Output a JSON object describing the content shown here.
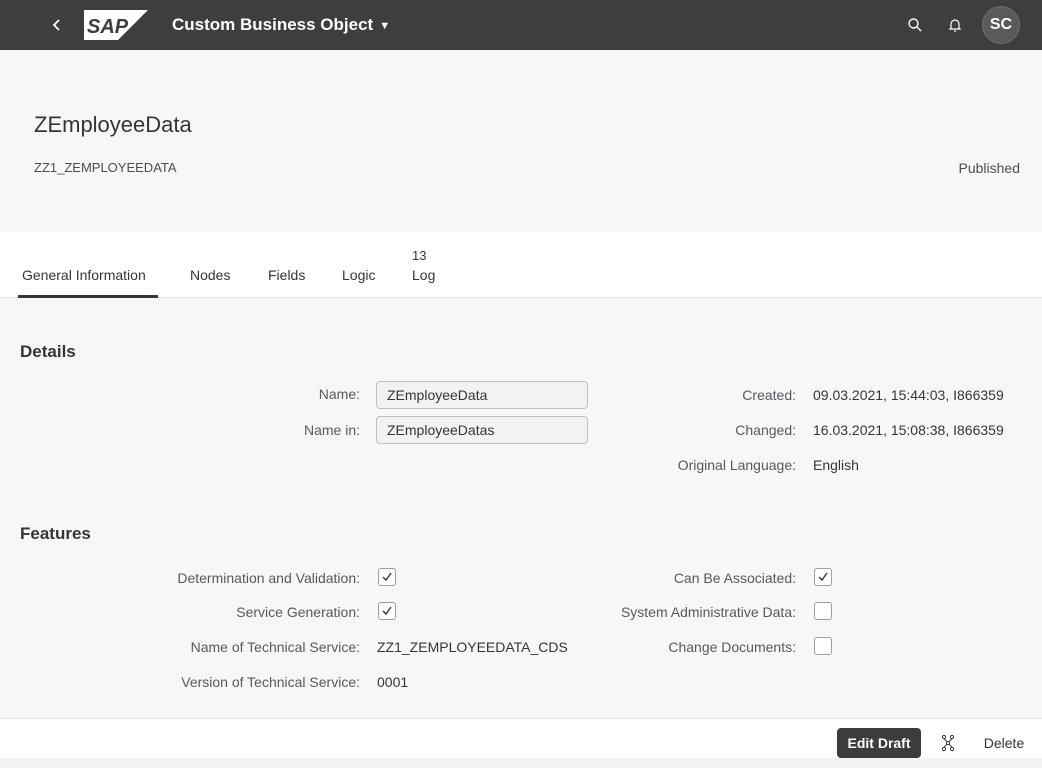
{
  "shell": {
    "app_title": "Custom Business Object",
    "logo_text": "SAP",
    "avatar_initials": "SC",
    "icons": [
      "back-icon",
      "search-icon",
      "bell-icon"
    ]
  },
  "header": {
    "title": "ZEmployeeData",
    "subtitle": "ZZ1_ZEMPLOYEEDATA",
    "status": "Published"
  },
  "tabs": [
    {
      "label": "General Information",
      "active": true
    },
    {
      "label": "Nodes"
    },
    {
      "label": "Fields"
    },
    {
      "label": "Logic"
    },
    {
      "label": "Log",
      "count": "13"
    }
  ],
  "details": {
    "title": "Details",
    "name_label": "Name:",
    "name_value": "ZEmployeeData",
    "name_in_label": "Name in:",
    "name_in_value": "ZEmployeeDatas",
    "created_label": "Created:",
    "created_value": "09.03.2021, 15:44:03, I866359",
    "changed_label": "Changed:",
    "changed_value": "16.03.2021, 15:08:38, I866359",
    "orig_lang_label": "Original Language:",
    "orig_lang_value": "English"
  },
  "features": {
    "title": "Features",
    "det_val_label": "Determination and Validation:",
    "det_val_checked": true,
    "svc_gen_label": "Service Generation:",
    "svc_gen_checked": true,
    "tech_svc_name_label": "Name of Technical Service:",
    "tech_svc_name_value": "ZZ1_ZEMPLOYEEDATA_CDS",
    "tech_svc_ver_label": "Version of Technical Service:",
    "tech_svc_ver_value": "0001",
    "can_assoc_label": "Can Be Associated:",
    "can_assoc_checked": true,
    "sys_admin_label": "System Administrative Data:",
    "sys_admin_checked": false,
    "change_docs_label": "Change Documents:",
    "change_docs_checked": false
  },
  "footer": {
    "edit_draft_label": "Edit Draft",
    "delete_label": "Delete"
  },
  "colors": {
    "shell_bg": "#3e3e3e",
    "page_bg": "#f7f7f7",
    "primary_button": "#3c3c3c"
  }
}
